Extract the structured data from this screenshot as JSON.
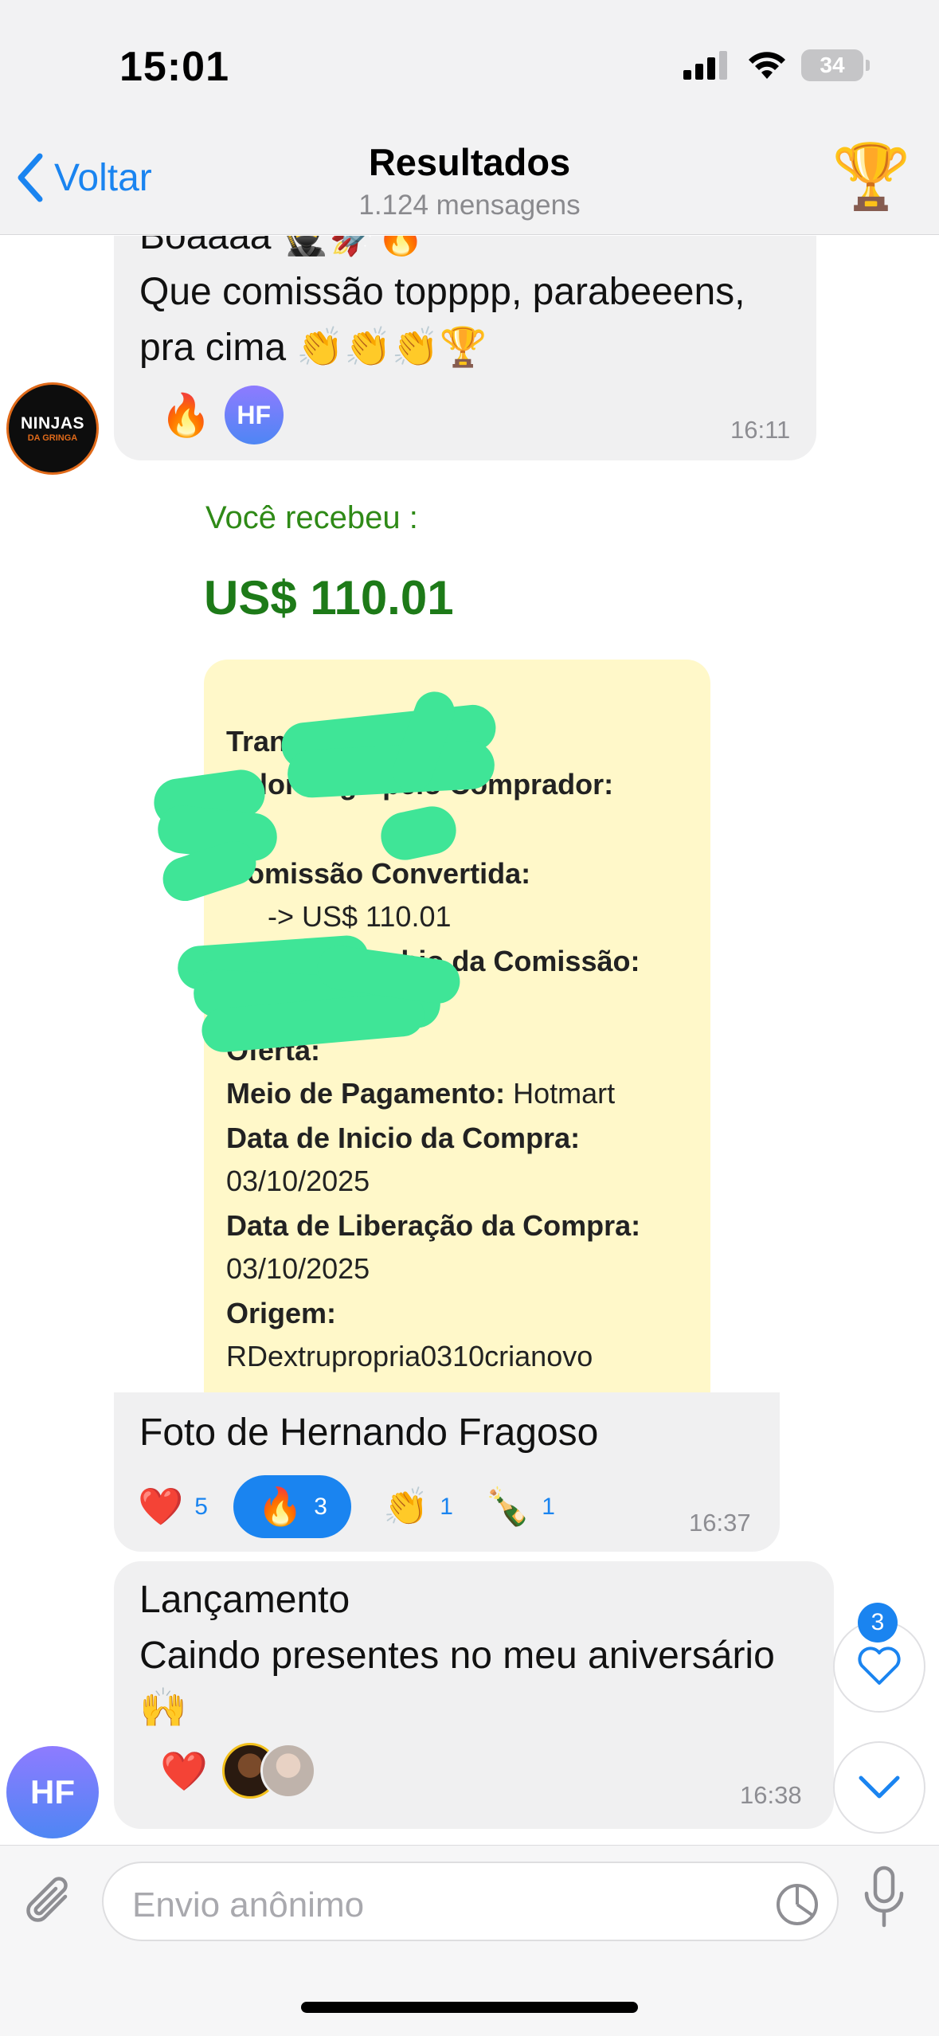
{
  "status_bar": {
    "time": "15:01",
    "battery": "34"
  },
  "header": {
    "back_label": "Voltar",
    "title": "Resultados",
    "subtitle": "1.124 mensagens",
    "trophy": "🏆"
  },
  "messages": {
    "first": {
      "line0": "Boaaaa 🥷🚀🔥",
      "line1": "Que comissão topppp, parabeeens,",
      "line2": "pra cima 👏👏👏🏆",
      "reaction_emoji": "🔥",
      "reactor_initials": "HF",
      "time": "16:11",
      "sender_avatar_text": "NINJAS",
      "sender_avatar_sub": "DA GRINGA"
    },
    "photo": {
      "received_label": "Você recebeu :",
      "amount": "US$ 110.01",
      "lines": [
        {
          "label": "Transação:",
          "value": ""
        },
        {
          "label": "Valor Pago pelo Comprador:",
          "value": ""
        },
        {
          "label": "Comissão Convertida:",
          "value": ""
        },
        {
          "label": "",
          "value": "-> US$ 110.01"
        },
        {
          "label": "Taxa de Cambio da Comissão:",
          "value": ""
        },
        {
          "label": "",
          "value": ""
        },
        {
          "label": "Oferta:",
          "value": ""
        },
        {
          "label": "Meio de Pagamento:",
          "value": " Hotmart"
        },
        {
          "label": "Data de Inicio da Compra:",
          "value": ""
        },
        {
          "label": "",
          "value": "03/10/2025"
        },
        {
          "label": "Data de Liberação da Compra:",
          "value": ""
        },
        {
          "label": "",
          "value": "03/10/2025"
        },
        {
          "label": "Origem:",
          "value": ""
        },
        {
          "label": "",
          "value": "RDextrupropria0310crianovo"
        }
      ],
      "caption": "Foto de Hernando Fragoso",
      "reactions": [
        {
          "emoji": "❤️",
          "count": "5"
        },
        {
          "emoji": "🔥",
          "count": "3"
        },
        {
          "emoji": "👏",
          "count": "1"
        },
        {
          "emoji": "🍾",
          "count": "1"
        }
      ],
      "time": "16:37"
    },
    "last": {
      "line1": "Lançamento",
      "line2": "Caindo presentes no meu aniversário",
      "line3": "🙌",
      "reaction_emoji": "❤️",
      "time": "16:38",
      "sender_initials": "HF"
    }
  },
  "floating": {
    "badge_count": "3"
  },
  "input": {
    "placeholder": "Envio anônimo"
  },
  "colors": {
    "accent": "#1a84f0",
    "bubble": "#f0f0f1",
    "receipt_bg": "#fff8c9",
    "scribble": "#3fe597"
  }
}
